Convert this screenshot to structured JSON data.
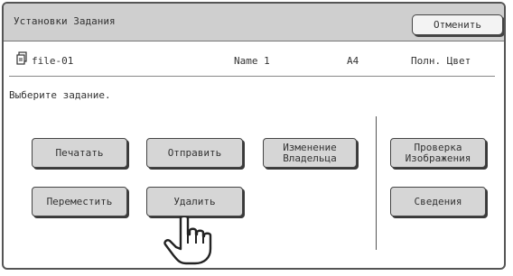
{
  "header": {
    "title": "Установки Задания",
    "cancel_label": "Отменить"
  },
  "file": {
    "icon": "document-icon",
    "name": "file-01",
    "user": "Name 1",
    "paper_size": "A4",
    "color_mode": "Полн. Цвет"
  },
  "prompt": "Выберите задание.",
  "actions": {
    "print": "Печатать",
    "send": "Отправить",
    "change_owner_line1": "Изменение",
    "change_owner_line2": "Владельца",
    "move": "Переместить",
    "delete": "Удалить",
    "check_image_line1": "Проверка",
    "check_image_line2": "Изображения",
    "details": "Сведения"
  },
  "pointer": {
    "icon": "hand-pointer-icon"
  }
}
